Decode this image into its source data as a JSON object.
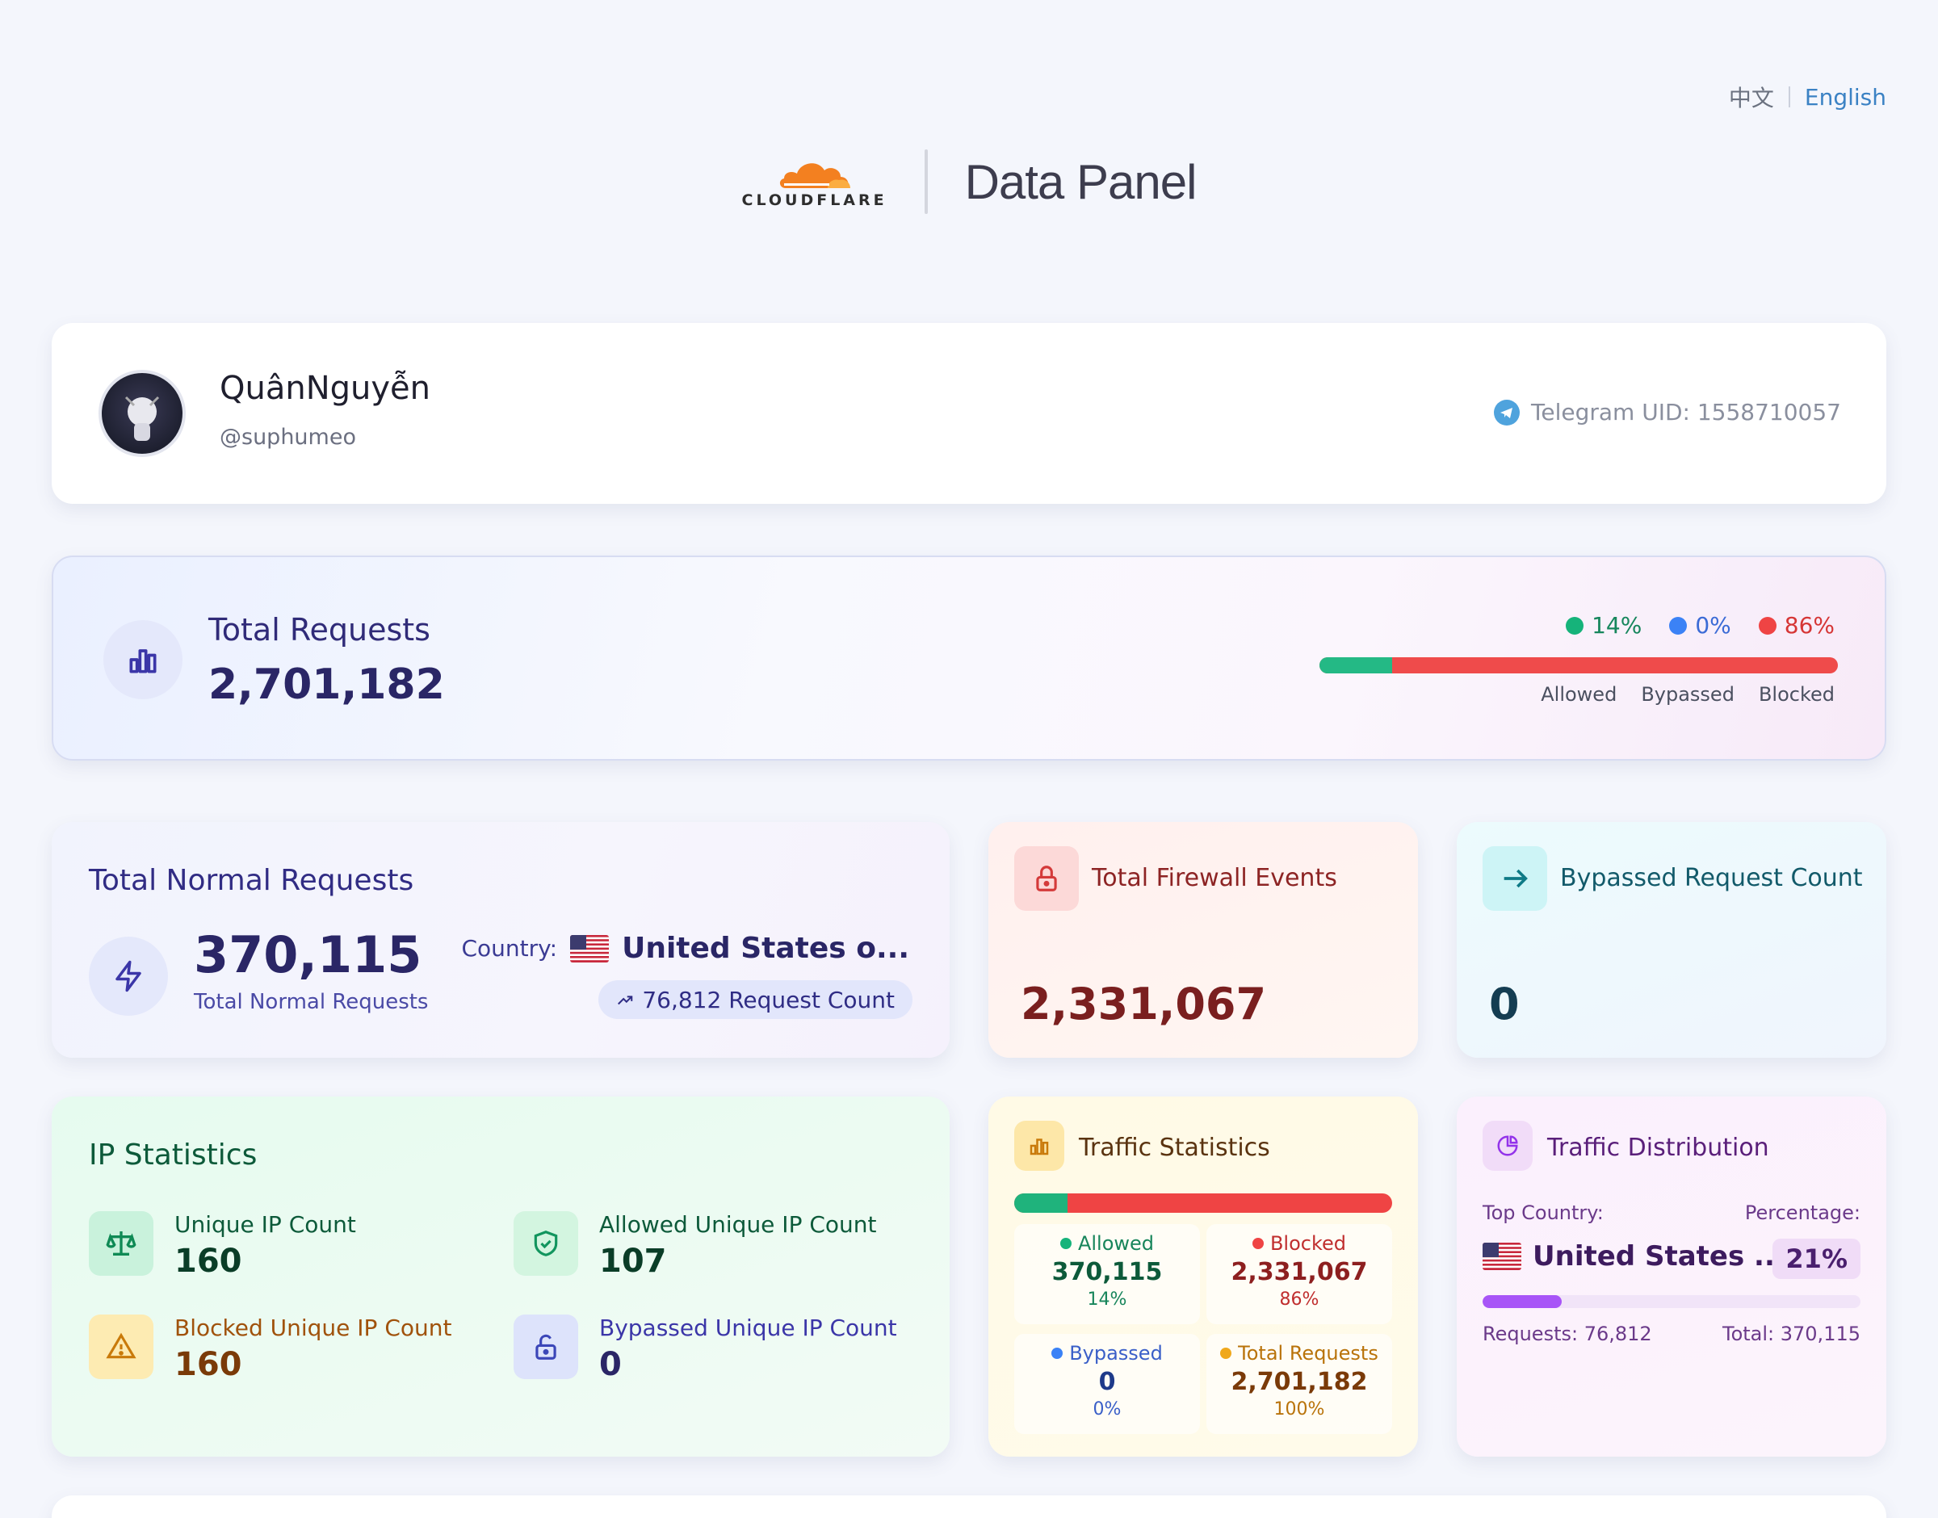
{
  "lang": {
    "zh": "中文",
    "en": "English"
  },
  "header": {
    "brand": "CLOUDFLARE",
    "title": "Data Panel"
  },
  "profile": {
    "name": "QuânNguyễn",
    "handle": "@suphumeo",
    "telegram": "Telegram UID: 1558710057"
  },
  "total": {
    "label": "Total Requests",
    "value": "2,701,182",
    "legend": [
      {
        "pct": "14%",
        "label": "Allowed",
        "color": "#16b37a",
        "share": 0.14
      },
      {
        "pct": "0%",
        "label": "Bypassed",
        "color": "#3b82f6",
        "share": 0.0
      },
      {
        "pct": "86%",
        "label": "Blocked",
        "color": "#ef4444",
        "share": 0.86
      }
    ]
  },
  "normal": {
    "title": "Total Normal Requests",
    "value": "370,115",
    "sub": "Total Normal Requests",
    "country_label": "Country:",
    "country": "United States o...",
    "request_count": "76,812 Request Count"
  },
  "firewall": {
    "title": "Total Firewall Events",
    "value": "2,331,067"
  },
  "bypassed": {
    "title": "Bypassed Request Count",
    "value": "0"
  },
  "ip": {
    "title": "IP Statistics",
    "unique": {
      "label": "Unique IP Count",
      "value": "160"
    },
    "allowed": {
      "label": "Allowed Unique IP Count",
      "value": "107"
    },
    "blocked": {
      "label": "Blocked Unique IP Count",
      "value": "160"
    },
    "bypassed": {
      "label": "Bypassed Unique IP Count",
      "value": "0"
    }
  },
  "traffic": {
    "title": "Traffic Statistics",
    "allowed": {
      "label": "Allowed",
      "value": "370,115",
      "pct": "14%",
      "share": 0.14
    },
    "blocked": {
      "label": "Blocked",
      "value": "2,331,067",
      "pct": "86%",
      "share": 0.86
    },
    "bypassed": {
      "label": "Bypassed",
      "value": "0",
      "pct": "0%"
    },
    "total": {
      "label": "Total Requests",
      "value": "2,701,182",
      "pct": "100%"
    }
  },
  "distribution": {
    "title": "Traffic Distribution",
    "top_country_label": "Top Country:",
    "percentage_label": "Percentage:",
    "country": "United States ...",
    "pct": "21%",
    "share": 0.21,
    "requests": "Requests: 76,812",
    "total": "Total: 370,115"
  }
}
